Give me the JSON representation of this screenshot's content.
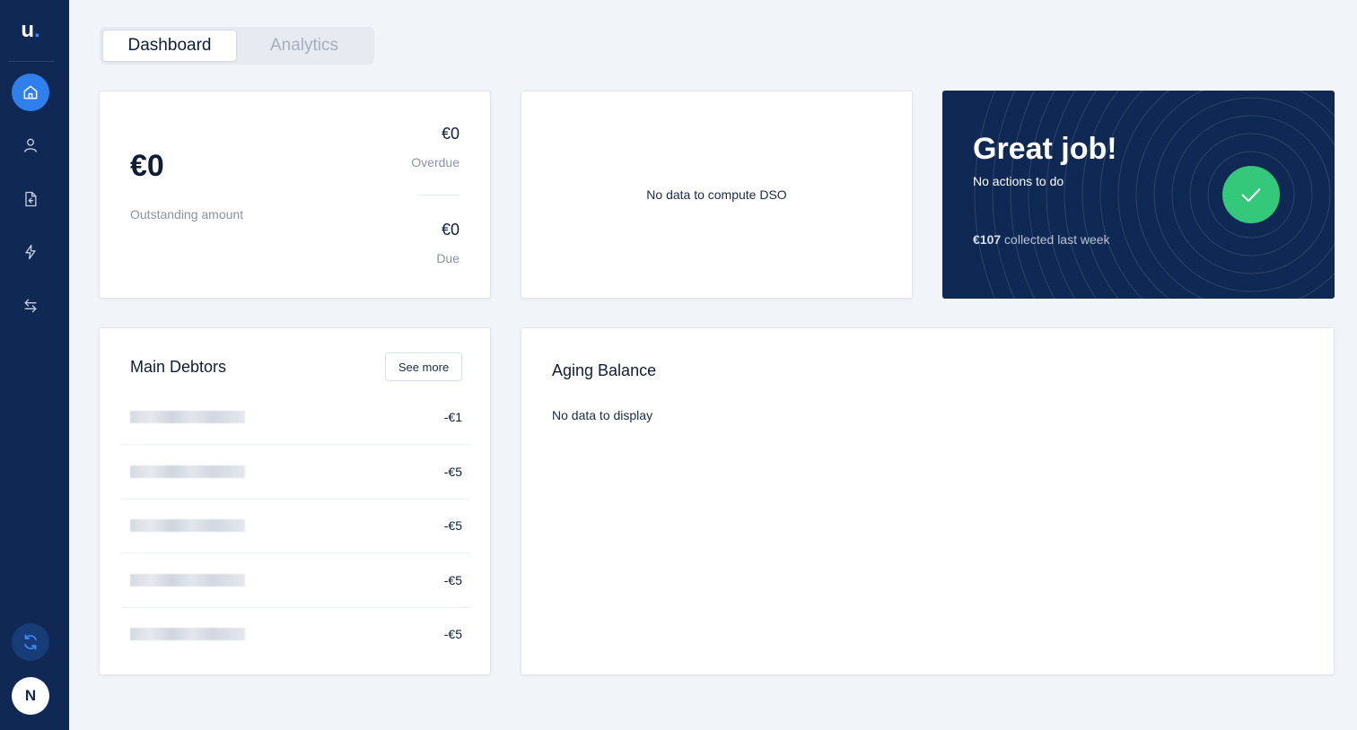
{
  "sidebar": {
    "logo_letter": "u",
    "logo_dot": ".",
    "items": [
      {
        "icon": "home-icon",
        "active": true
      },
      {
        "icon": "user-icon",
        "active": false
      },
      {
        "icon": "invoice-icon",
        "active": false
      },
      {
        "icon": "lightning-icon",
        "active": false
      },
      {
        "icon": "transfer-icon",
        "active": false
      }
    ],
    "sync_icon": "sync-icon",
    "avatar_initial": "N"
  },
  "tabs": [
    {
      "label": "Dashboard",
      "active": true
    },
    {
      "label": "Analytics",
      "active": false
    }
  ],
  "outstanding": {
    "amount": "€0",
    "label": "Outstanding amount",
    "overdue_amount": "€0",
    "overdue_label": "Overdue",
    "due_amount": "€0",
    "due_label": "Due"
  },
  "dso": {
    "empty_text": "No data to compute DSO"
  },
  "great_job": {
    "title": "Great job!",
    "subtitle": "No actions to do",
    "collected_amount": "€107",
    "collected_text": " collected last week",
    "colors": {
      "background": "#0f2954",
      "check": "#34c97a"
    }
  },
  "main_debtors": {
    "title": "Main Debtors",
    "see_more_label": "See more",
    "rows": [
      {
        "name": "",
        "amount": "-€1"
      },
      {
        "name": "",
        "amount": "-€5"
      },
      {
        "name": "",
        "amount": "-€5"
      },
      {
        "name": "",
        "amount": "-€5"
      },
      {
        "name": "",
        "amount": "-€5"
      }
    ]
  },
  "aging_balance": {
    "title": "Aging Balance",
    "empty_text": "No data to display"
  },
  "colors": {
    "sidebar": "#0f2954",
    "accent": "#2f80ed",
    "page_background": "#f1f4f8"
  }
}
